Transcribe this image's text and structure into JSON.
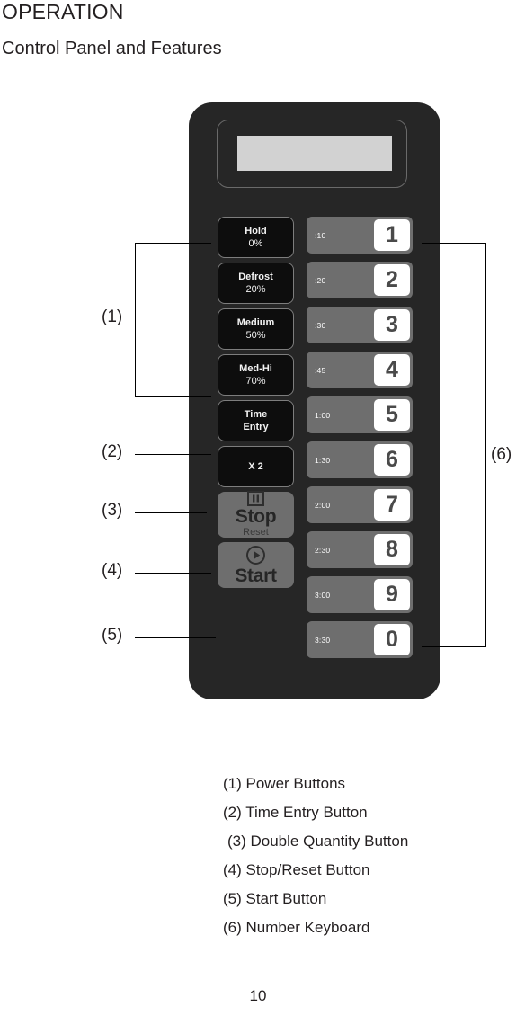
{
  "document": {
    "heading": "OPERATION",
    "subheading": "Control Panel and Features",
    "page_number": "10"
  },
  "control_panel": {
    "display": {
      "name": "lcd-display",
      "screen_color": "#d2d2d2"
    },
    "panel_color": "#262626",
    "power_buttons": [
      {
        "line1": "Hold",
        "line2": "0%"
      },
      {
        "line1": "Defrost",
        "line2": "20%"
      },
      {
        "line1": "Medium",
        "line2": "50%"
      },
      {
        "line1": "Med-Hi",
        "line2": "70%"
      }
    ],
    "time_entry_button": {
      "line1": "Time",
      "line2": "Entry"
    },
    "double_quantity_button": {
      "label": "X 2"
    },
    "stop_button": {
      "label": "Stop",
      "sub_label": "Reset",
      "icon": "pause-icon"
    },
    "start_button": {
      "label": "Start",
      "icon": "play-icon"
    },
    "keypad": [
      {
        "time": ":10",
        "digit": "1"
      },
      {
        "time": ":20",
        "digit": "2"
      },
      {
        "time": ":30",
        "digit": "3"
      },
      {
        "time": ":45",
        "digit": "4"
      },
      {
        "time": "1:00",
        "digit": "5"
      },
      {
        "time": "1:30",
        "digit": "6"
      },
      {
        "time": "2:00",
        "digit": "7"
      },
      {
        "time": "2:30",
        "digit": "8"
      },
      {
        "time": "3:00",
        "digit": "9"
      },
      {
        "time": "3:30",
        "digit": "0"
      }
    ]
  },
  "callouts": {
    "c1": "(1)",
    "c2": "(2)",
    "c3": "(3)",
    "c4": "(4)",
    "c5": "(5)",
    "c6": "(6)"
  },
  "legend": {
    "items": [
      "(1) Power Buttons",
      "(2) Time Entry Button",
      "(3) Double Quantity Button",
      "(4) Stop/Reset Button",
      "(5) Start Button",
      "(6) Number Keyboard"
    ]
  }
}
